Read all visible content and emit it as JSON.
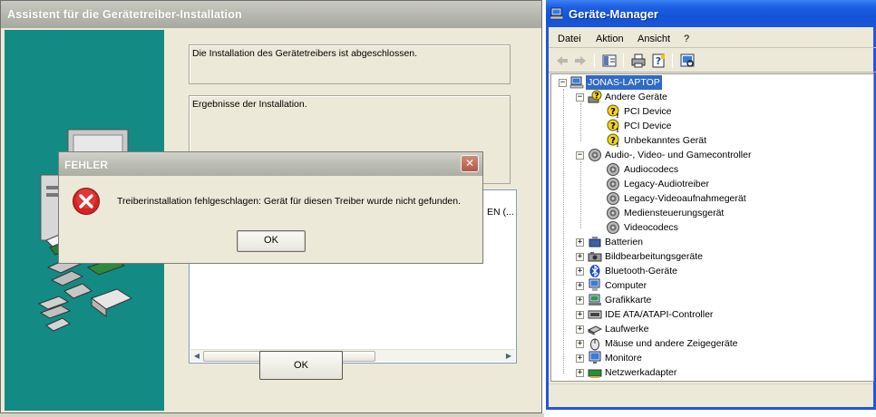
{
  "wizard": {
    "title": "Assistent für die Gerätetreiber-Installation",
    "status_text": "Die Installation des Gerätetreibers ist abgeschlossen.",
    "results_text": "Ergebnisse der Installation.",
    "list_cut_text": "EN (...",
    "ok_label": "OK"
  },
  "error_dialog": {
    "title": "FEHLER",
    "message": "Treiberinstallation fehlgeschlagen: Gerät für diesen Treiber wurde nicht gefunden.",
    "ok_label": "OK",
    "close_glyph": "✕"
  },
  "device_manager": {
    "title": "Geräte-Manager",
    "menu": [
      "Datei",
      "Aktion",
      "Ansicht",
      "?"
    ],
    "toolbar_icons": [
      "back-icon",
      "forward-icon",
      "properties-view-icon",
      "print-icon",
      "help-icon",
      "scan-hardware-icon"
    ],
    "root": "JONAS-LAPTOP",
    "groups": [
      {
        "label": "Andere Geräte",
        "expanded": true,
        "icon": "unknown-device-icon",
        "children": [
          "PCI Device",
          "PCI Device",
          "Unbekanntes Gerät"
        ]
      },
      {
        "label": "Audio-, Video- und Gamecontroller",
        "expanded": true,
        "icon": "speaker-icon",
        "children": [
          "Audiocodecs",
          "Legacy-Audiotreiber",
          "Legacy-Videoaufnahmegerät",
          "Mediensteuerungsgerät",
          "Videocodecs"
        ]
      },
      {
        "label": "Batterien",
        "expanded": false,
        "icon": "battery-icon"
      },
      {
        "label": "Bildbearbeitungsgeräte",
        "expanded": false,
        "icon": "camera-icon"
      },
      {
        "label": "Bluetooth-Geräte",
        "expanded": false,
        "icon": "bluetooth-icon"
      },
      {
        "label": "Computer",
        "expanded": false,
        "icon": "computer-icon"
      },
      {
        "label": "Grafikkarte",
        "expanded": false,
        "icon": "display-adapter-icon"
      },
      {
        "label": "IDE ATA/ATAPI-Controller",
        "expanded": false,
        "icon": "ide-controller-icon"
      },
      {
        "label": "Laufwerke",
        "expanded": false,
        "icon": "disk-drive-icon"
      },
      {
        "label": "Mäuse und andere Zeigegeräte",
        "expanded": false,
        "icon": "mouse-icon"
      },
      {
        "label": "Monitore",
        "expanded": false,
        "icon": "monitor-icon"
      },
      {
        "label": "Netzwerkadapter",
        "expanded": false,
        "icon": "network-adapter-icon"
      }
    ]
  },
  "colors": {
    "wizard_side": "#138a83",
    "xp_blue": "#1353d8",
    "selection": "#316ac5",
    "error_red": "#d21d1d"
  }
}
